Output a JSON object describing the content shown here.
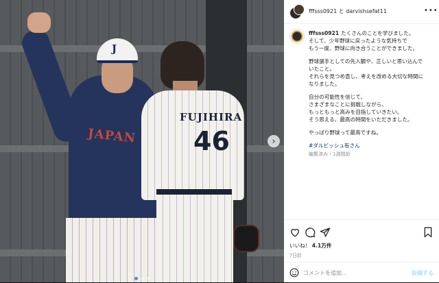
{
  "header": {
    "usernames": "fffsss0921 と darvishsefat11",
    "more_icon": "more-horizontal-icon"
  },
  "photo": {
    "cap_letter": "J",
    "jersey_left": "JAPAN",
    "jersey_name": "FUJIHIRA",
    "jersey_number": "46",
    "carousel_next_glyph": "›",
    "slide_index": 1,
    "slide_count": 3
  },
  "caption": {
    "username": "fffsss0921",
    "p1_first": "たくさんのことを学びました。",
    "p1_rest": "そして、少年野球に戻ったような気持ちで\nもう一度、野球に向き合うことができました。",
    "p2": "野球選手としての先入観や、正しいと思い込んで\nいたこと。\nそれらを見つめ直し、考えを改める大切な時間に\nなりました。",
    "p3": "自分の可能性を信じて、\nさまざまなことに挑戦しながら、\nもっともっと高みを目指していきたい。\nそう思える、最高の時間をいただきました。",
    "p4": "やっぱり野球って最高ですね。",
    "hashtag": "#ダルビッシュ有さん",
    "meta": "編集済み・1週間前"
  },
  "actions": {
    "icons": [
      "heart-icon",
      "comment-icon",
      "share-icon",
      "bookmark-icon"
    ]
  },
  "likes": {
    "label": "いいね！",
    "count": "4.1万件"
  },
  "posted_ago": "7日前",
  "comment": {
    "placeholder": "コメントを追加...",
    "post_label": "投稿する"
  },
  "colors": {
    "link": "#00376b",
    "post_button": "#b2dffc",
    "active_dot": "#3797f0"
  }
}
